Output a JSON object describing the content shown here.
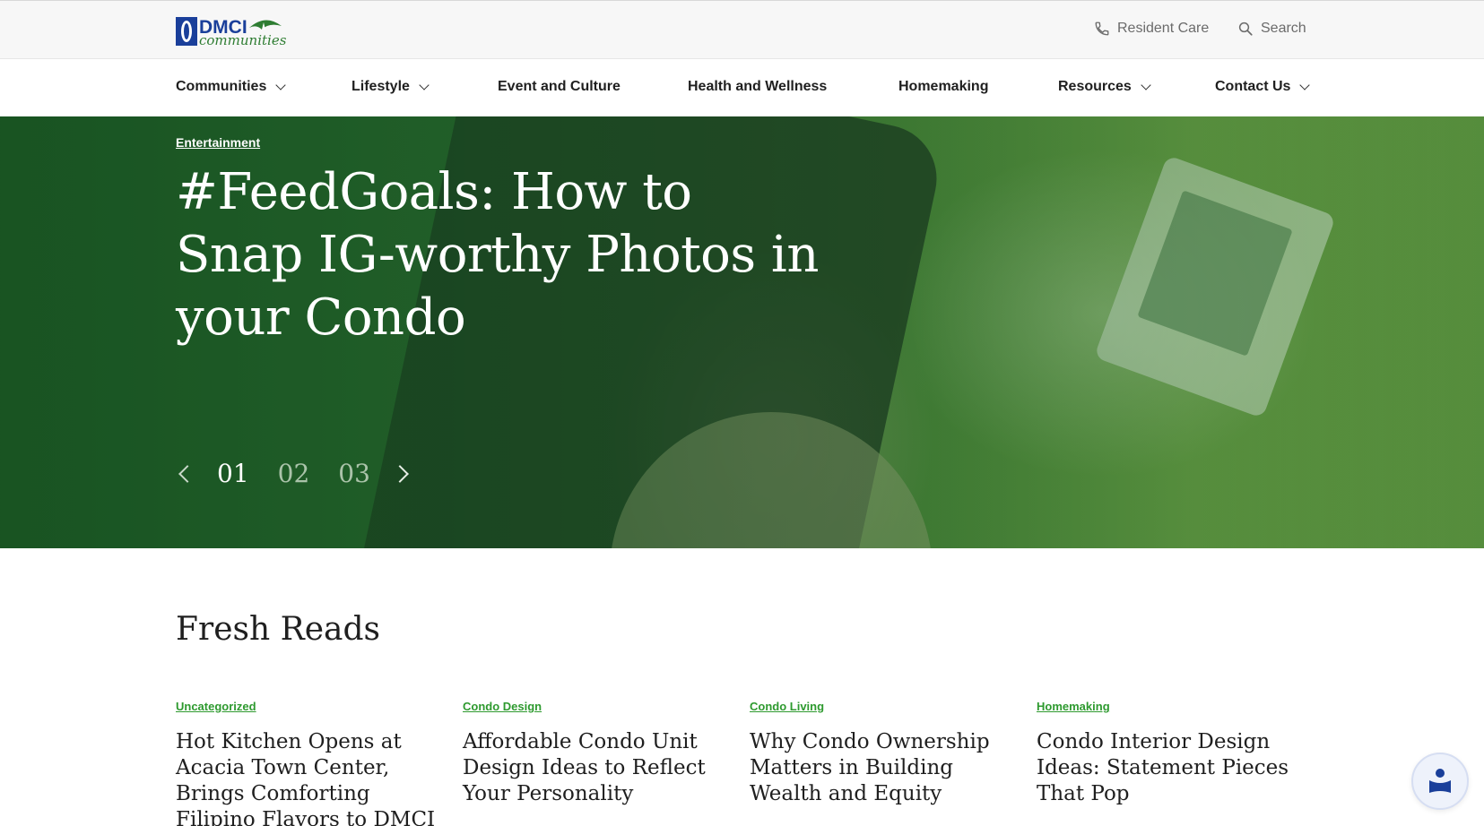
{
  "header": {
    "logo_text": "DMCI communities",
    "resident_care": "Resident Care",
    "search": "Search"
  },
  "nav": {
    "items": [
      {
        "label": "Communities",
        "dropdown": true
      },
      {
        "label": "Lifestyle",
        "dropdown": true
      },
      {
        "label": "Event and Culture",
        "dropdown": false
      },
      {
        "label": "Health and Wellness",
        "dropdown": false
      },
      {
        "label": "Homemaking",
        "dropdown": false
      },
      {
        "label": "Resources",
        "dropdown": true
      },
      {
        "label": "Contact Us",
        "dropdown": true
      }
    ]
  },
  "hero": {
    "category": "Entertainment",
    "title": "#FeedGoals: How to Snap IG-worthy Photos in your Condo",
    "slides": [
      "01",
      "02",
      "03"
    ],
    "active_slide": "01"
  },
  "fresh_reads": {
    "heading": "Fresh Reads",
    "cards": [
      {
        "category": "Uncategorized",
        "title": "Hot Kitchen Opens at Acacia Town Center, Brings Comforting Filipino Flavors to DMCI Communities"
      },
      {
        "category": "Condo Design",
        "title": "Affordable Condo Unit Design Ideas to Reflect Your Personality"
      },
      {
        "category": "Condo Living",
        "title": "Why Condo Ownership Matters in Building Wealth and Equity"
      },
      {
        "category": "Homemaking",
        "title": "Condo Interior Design Ideas: Statement Pieces That Pop"
      }
    ]
  },
  "colors": {
    "brand_blue": "#1a3f9a",
    "brand_green": "#2e7d32",
    "category_green": "#2e9a2f",
    "hero_green": "#1e5a2a"
  }
}
